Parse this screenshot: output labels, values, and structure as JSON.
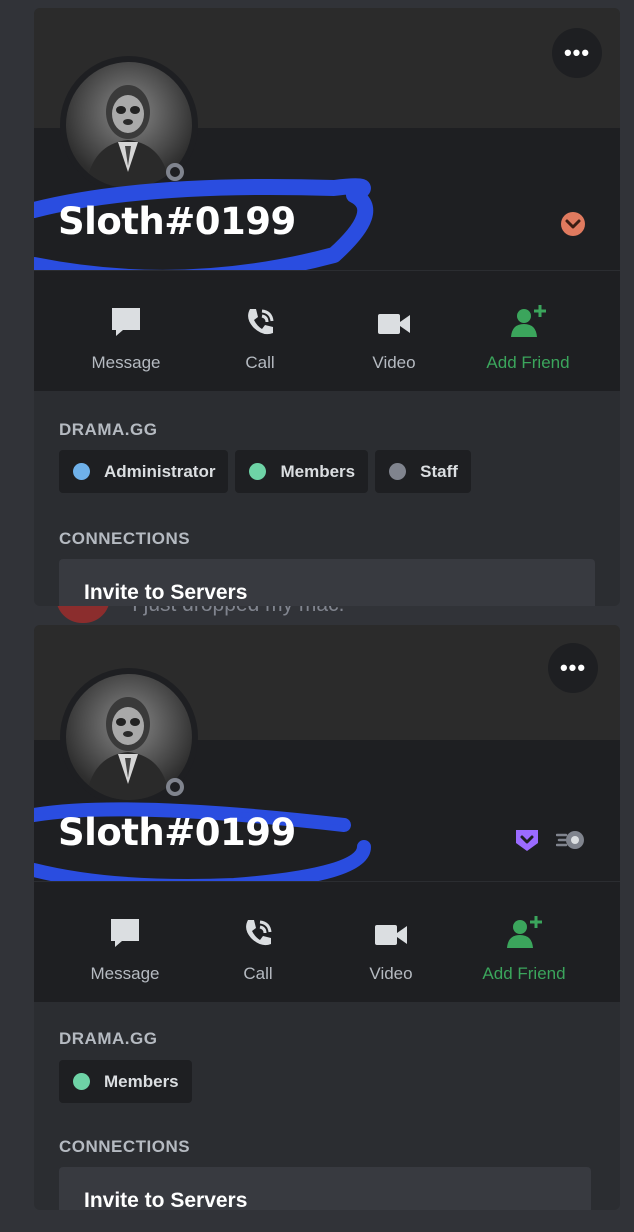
{
  "profiles": [
    {
      "username": "Sloth#0199",
      "actions": {
        "message": "Message",
        "call": "Call",
        "video": "Video",
        "add_friend": "Add Friend"
      },
      "server_name": "DRAMA.GG",
      "roles": [
        {
          "name": "Administrator",
          "color": "#6fb1ea"
        },
        {
          "name": "Members",
          "color": "#6ed3a6"
        },
        {
          "name": "Staff",
          "color": "#80848e"
        }
      ],
      "connections_title": "CONNECTIONS",
      "invite_label": "Invite to Servers",
      "badges": [
        "hypesquad-bravery-icon"
      ]
    },
    {
      "username": "Sloth#0199",
      "actions": {
        "message": "Message",
        "call": "Call",
        "video": "Video",
        "add_friend": "Add Friend"
      },
      "server_name": "DRAMA.GG",
      "roles": [
        {
          "name": "Members",
          "color": "#6ed3a6"
        }
      ],
      "connections_title": "CONNECTIONS",
      "invite_label": "Invite to Servers",
      "badges": [
        "nitro-shield-icon",
        "boost-icon"
      ]
    }
  ],
  "background_message": "I just dropped my mac.",
  "colors": {
    "accent_green": "#3ba55c",
    "scribble_blue": "#2a4de0",
    "bravery_badge": "#e07a5f",
    "nitro_purple": "#9b6bff"
  }
}
